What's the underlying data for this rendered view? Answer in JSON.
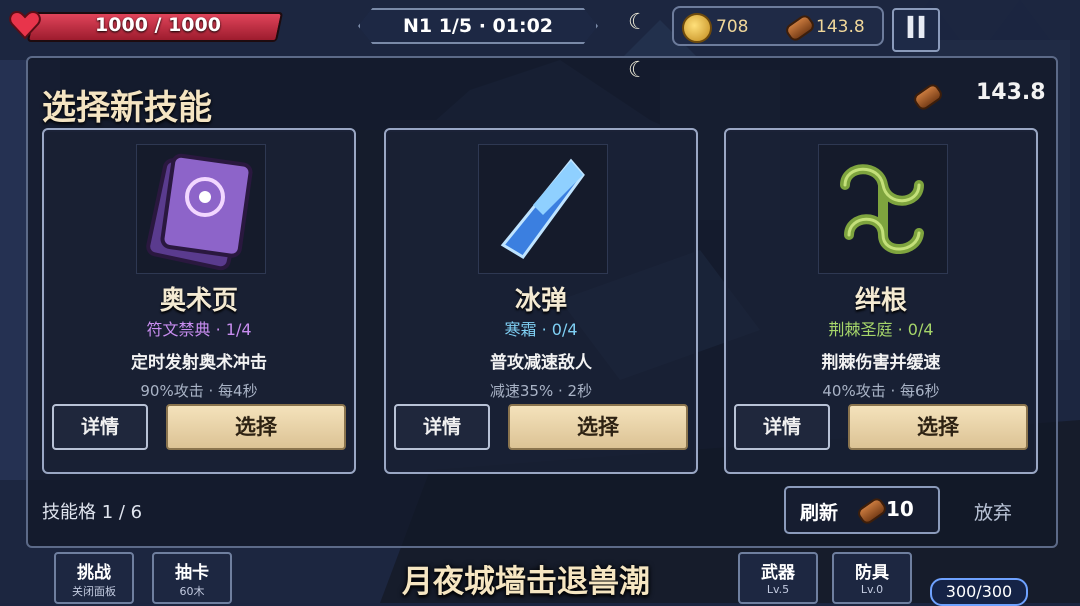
{
  "hud": {
    "hp_text": "1000 / 1000",
    "hp_fraction": 1.0,
    "wave_text": "N1 1/5 · 01:02",
    "gold": "708",
    "wood": "143.8",
    "pause_label": "II"
  },
  "modal": {
    "title": "选择新技能",
    "wood_total": "143.8",
    "slots": "技能格  1 / 6",
    "refresh_label": "刷新",
    "refresh_cost": "10",
    "abandon_label": "放弃"
  },
  "cards": [
    {
      "name": "奥术页",
      "school": "符文禁典",
      "level": "1/4",
      "school_color": "#c88df0",
      "desc": "定时发射奥术冲击",
      "stats": "90%攻击 · 每4秒",
      "detail_label": "详情",
      "select_label": "选择",
      "icon": "arcane-page-icon"
    },
    {
      "name": "冰弹",
      "school": "寒霜",
      "level": "0/4",
      "school_color": "#7fd0f4",
      "desc": "普攻减速敌人",
      "stats": "减速35% · 2秒",
      "detail_label": "详情",
      "select_label": "选择",
      "icon": "ice-crystal-icon"
    },
    {
      "name": "绊根",
      "school": "荆棘圣庭",
      "level": "0/4",
      "school_color": "#a6d66a",
      "desc": "荆棘伤害并缓速",
      "stats": "40%攻击 · 每6秒",
      "detail_label": "详情",
      "select_label": "选择",
      "icon": "thorn-vine-icon"
    }
  ],
  "bottom": {
    "challenge_label": "挑战",
    "challenge_sub": "关闭面板",
    "draw_label": "抽卡",
    "draw_sub": "60木",
    "stage_title": "月夜城墙击退兽潮",
    "weapon_label": "武器",
    "weapon_sub": "Lv.5",
    "armor_label": "防具",
    "armor_sub": "Lv.0",
    "xp_text": "300/300"
  }
}
